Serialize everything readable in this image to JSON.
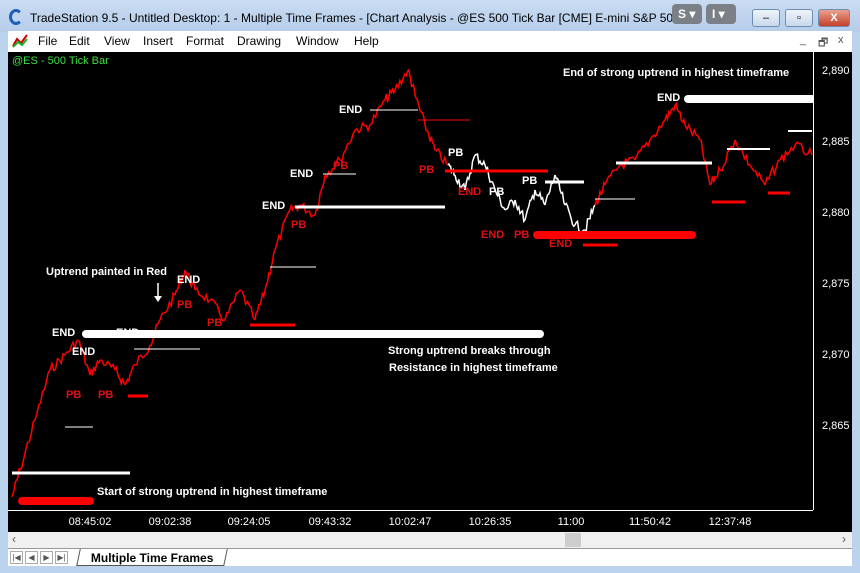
{
  "window": {
    "title": "TradeStation 9.5 - Untitled Desktop: 1 - Multiple Time Frames - [Chart Analysis - @ES 500 Tick Bar [CME] E-mini S&P 500 C...",
    "s_button": "S",
    "i_button": "I",
    "minimize": "–",
    "maximize": "▫",
    "close": "X"
  },
  "menu": [
    "File",
    "Edit",
    "View",
    "Insert",
    "Format",
    "Drawing",
    "Window",
    "Help"
  ],
  "mdi": {
    "minimize": "_",
    "restore": "🗗",
    "close": "x"
  },
  "chart": {
    "symbol_label": "@ES - 500 Tick Bar",
    "y_ticks": [
      "2,890",
      "2,885",
      "2,880",
      "2,875",
      "2,870",
      "2,865"
    ],
    "x_ticks": [
      "08:45:02",
      "09:02:38",
      "09:24:05",
      "09:43:32",
      "10:02:47",
      "10:26:35",
      "11:00",
      "11:50:42",
      "12:37:48"
    ],
    "labels": [
      {
        "text": "END",
        "color": "#ffffff"
      },
      {
        "text": "END",
        "color": "#ffffff"
      },
      {
        "text": "END",
        "color": "#ffffff"
      },
      {
        "text": "PB",
        "color": "#e01010"
      },
      {
        "text": "PB",
        "color": "#e01010"
      },
      {
        "text": "END",
        "color": "#ffffff"
      },
      {
        "text": "PB",
        "color": "#e01010"
      },
      {
        "text": "PB",
        "color": "#e01010"
      },
      {
        "text": "END",
        "color": "#ffffff"
      },
      {
        "text": "PB",
        "color": "#e01010"
      },
      {
        "text": "END",
        "color": "#ffffff"
      },
      {
        "text": "PB",
        "color": "#e01010"
      },
      {
        "text": "END",
        "color": "#ffffff"
      },
      {
        "text": "PB",
        "color": "#e01010"
      },
      {
        "text": "PB",
        "color": "#ffffff"
      },
      {
        "text": "END",
        "color": "#e01010"
      },
      {
        "text": "PB",
        "color": "#ffffff"
      },
      {
        "text": "PB",
        "color": "#ffffff"
      },
      {
        "text": "END",
        "color": "#e01010"
      },
      {
        "text": "PB",
        "color": "#e01010"
      },
      {
        "text": "END",
        "color": "#e01010"
      },
      {
        "text": "END",
        "color": "#ffffff"
      }
    ],
    "notes": [
      "End of strong uptrend in highest timeframe",
      "Uptrend painted in Red",
      "Strong uptrend breaks through",
      "Resistance in highest timeframe",
      "Start of strong uptrend in highest timeframe"
    ],
    "colors": {
      "uptrend": "#ff0000",
      "other": "#ffffff",
      "background": "#000000",
      "symbol": "#3ee03e"
    }
  },
  "tabs": {
    "active": "Multiple Time Frames",
    "nav": [
      "|◀",
      "◀",
      "▶",
      "▶|"
    ]
  },
  "scroll": {
    "left": "‹",
    "right": "›"
  }
}
